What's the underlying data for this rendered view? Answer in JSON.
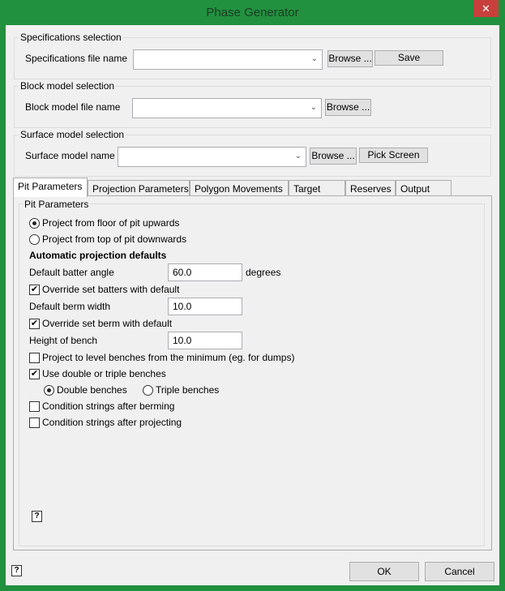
{
  "window": {
    "title": "Phase Generator",
    "close": "✕"
  },
  "spec": {
    "group": "Specifications selection",
    "label": "Specifications file name",
    "value": "",
    "browse": "Browse ...",
    "save": "Save"
  },
  "block": {
    "group": "Block model selection",
    "label": "Block model file name",
    "value": "",
    "browse": "Browse ..."
  },
  "surface": {
    "group": "Surface model selection",
    "label": "Surface model name",
    "value": "",
    "browse": "Browse ...",
    "pick": "Pick Screen"
  },
  "tabs": [
    "Pit Parameters",
    "Projection Parameters",
    "Polygon Movements",
    "Target",
    "Reserves",
    "Output"
  ],
  "pit": {
    "group": "Pit Parameters",
    "radio_floor": "Project from floor of pit upwards",
    "radio_top": "Project from top of pit downwards",
    "heading": "Automatic projection defaults",
    "batter_label": "Default batter angle",
    "batter_value": "60.0",
    "batter_unit": "degrees",
    "override_batters": "Override set batters with default",
    "berm_label": "Default berm width",
    "berm_value": "10.0",
    "override_berm": "Override set berm with default",
    "bench_label": "Height of bench",
    "bench_value": "10.0",
    "level_benches": "Project to level benches from the minimum (eg. for dumps)",
    "double_triple": "Use double or triple benches",
    "double": "Double benches",
    "triple": "Triple benches",
    "cond_berming": "Condition strings after berming",
    "cond_projecting": "Condition strings after projecting"
  },
  "footer": {
    "ok": "OK",
    "cancel": "Cancel"
  },
  "icons": {
    "help": "?",
    "check": "✔",
    "arrow": "⌄"
  }
}
